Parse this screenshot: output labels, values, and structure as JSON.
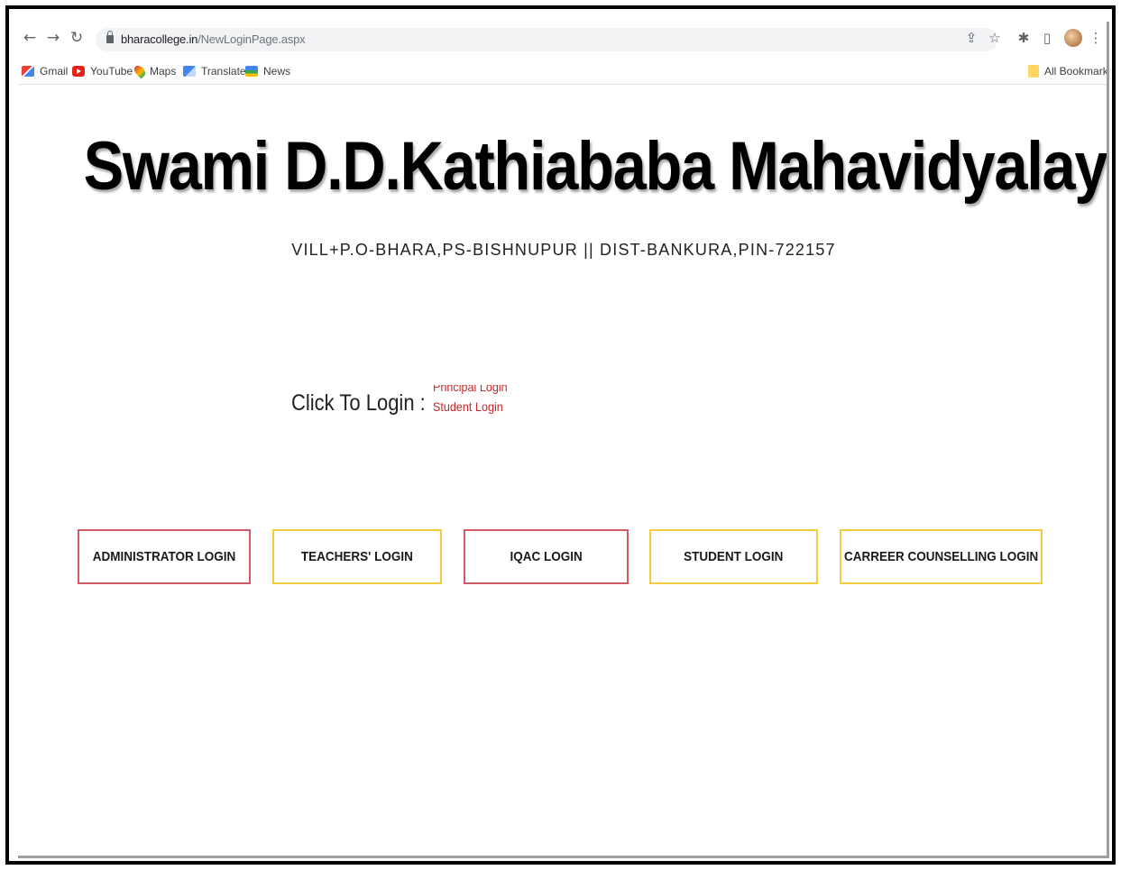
{
  "browser": {
    "url_domain": "bharacollege.in",
    "url_path": "/NewLoginPage.aspx"
  },
  "bookmarks": {
    "items": [
      {
        "label": "Gmail",
        "icon": "gmail-icon"
      },
      {
        "label": "YouTube",
        "icon": "youtube-icon"
      },
      {
        "label": "Maps",
        "icon": "maps-icon"
      },
      {
        "label": "Translate",
        "icon": "translate-icon"
      },
      {
        "label": "News",
        "icon": "news-icon"
      }
    ],
    "all_bookmarks_label": "All Bookmarks"
  },
  "page": {
    "title": "Swami D.D.Kathiababa Mahavidyalaya",
    "address": "VILL+P.O-BHARA,PS-BISHNUPUR || DIST-BANKURA,PIN-722157",
    "click_label": "Click To Login :",
    "ticker_links": [
      "Principal Login",
      "Student Login"
    ],
    "login_buttons": [
      {
        "label": "ADMINISTRATOR LOGIN",
        "border": "#d35a66"
      },
      {
        "label": "TEACHERS' LOGIN",
        "border": "#f3cd3f"
      },
      {
        "label": "IQAC LOGIN",
        "border": "#d35a66"
      },
      {
        "label": "STUDENT LOGIN",
        "border": "#f3cd3f"
      },
      {
        "label": "CARREER COUNSELLING LOGIN",
        "border": "#f3cd3f"
      }
    ]
  },
  "colors": {
    "ticker_link": "#c62828",
    "button_red_border": "#d35a66",
    "button_yellow_border": "#f3cd3f"
  }
}
